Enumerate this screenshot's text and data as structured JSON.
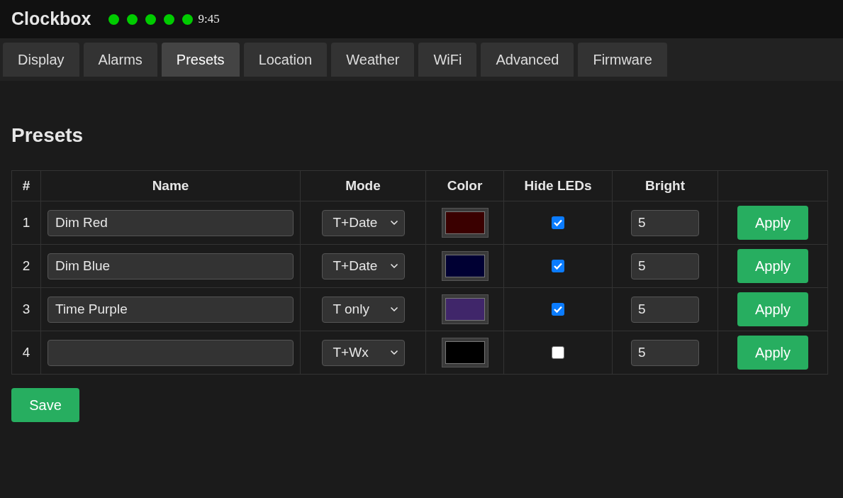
{
  "header": {
    "title": "Clockbox",
    "status_dots": [
      {
        "on": true
      },
      {
        "on": true
      },
      {
        "on": true
      },
      {
        "on": true
      },
      {
        "on": true
      }
    ],
    "time": "9:45"
  },
  "tabs": [
    {
      "label": "Display",
      "selected": false
    },
    {
      "label": "Alarms",
      "selected": false
    },
    {
      "label": "Presets",
      "selected": true
    },
    {
      "label": "Location",
      "selected": false
    },
    {
      "label": "Weather",
      "selected": false
    },
    {
      "label": "WiFi",
      "selected": false
    },
    {
      "label": "Advanced",
      "selected": false
    },
    {
      "label": "Firmware",
      "selected": false
    }
  ],
  "heading": "Presets",
  "table": {
    "columns": [
      "#",
      "Name",
      "Mode",
      "Color",
      "Hide LEDs",
      "Bright"
    ],
    "rows": [
      {
        "number": "1",
        "name": "Dim Red",
        "mode": "T+Date",
        "color": "#3a0000",
        "hide_leds": true,
        "bright": "5",
        "action": "Apply"
      },
      {
        "number": "2",
        "name": "Dim Blue",
        "mode": "T+Date",
        "color": "#000033",
        "hide_leds": true,
        "bright": "5",
        "action": "Apply"
      },
      {
        "number": "3",
        "name": "Time Purple",
        "mode": "T only",
        "color": "#40266a",
        "hide_leds": true,
        "bright": "5",
        "action": "Apply"
      },
      {
        "number": "4",
        "mode": "T+Wx",
        "color": "#000000",
        "hide_leds": false,
        "bright": "5",
        "action": "Apply"
      }
    ]
  },
  "save_button": "Save"
}
